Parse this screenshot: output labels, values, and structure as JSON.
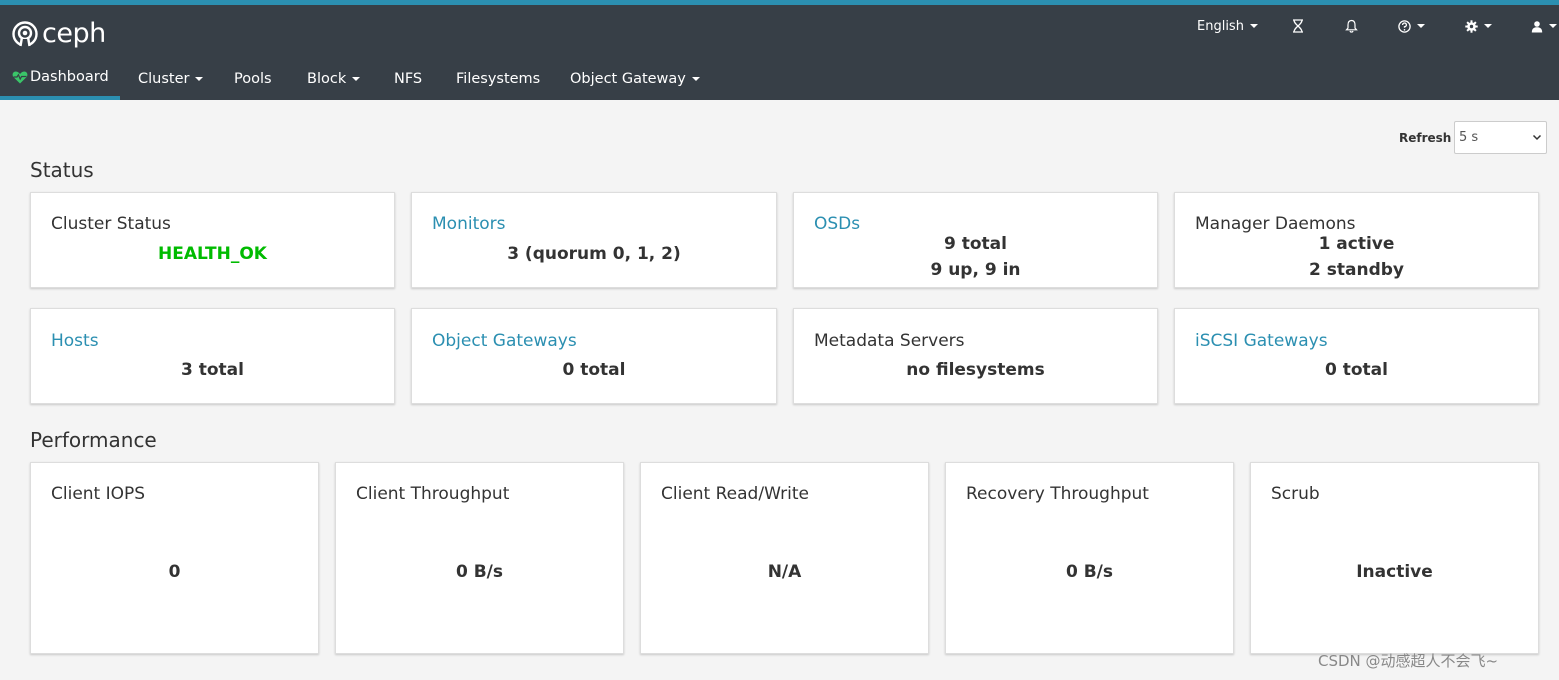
{
  "colors": {
    "navbar": "#373f47",
    "accent": "#2b8fb1",
    "health_ok": "#00bb00",
    "background": "#f4f4f4"
  },
  "header": {
    "logo_text": "ceph",
    "language": "English",
    "icons": [
      "hourglass-icon",
      "bell-icon",
      "help-icon",
      "gear-icon",
      "user-icon"
    ]
  },
  "nav": {
    "tabs": [
      {
        "label": "Dashboard",
        "active": true,
        "icon": "heartbeat-icon"
      },
      {
        "label": "Cluster",
        "dropdown": true
      },
      {
        "label": "Pools"
      },
      {
        "label": "Block",
        "dropdown": true
      },
      {
        "label": "NFS"
      },
      {
        "label": "Filesystems"
      },
      {
        "label": "Object Gateway",
        "dropdown": true
      }
    ]
  },
  "refresh": {
    "label": "Refresh",
    "value": "5 s"
  },
  "status": {
    "title": "Status",
    "cards": [
      {
        "title": "Cluster Status",
        "values": [
          "HEALTH_OK"
        ]
      },
      {
        "title": "Monitors",
        "values": [
          "3 (quorum 0, 1, 2)"
        ]
      },
      {
        "title": "OSDs",
        "values": [
          "9 total",
          "9 up, 9 in"
        ]
      },
      {
        "title": "Manager Daemons",
        "values": [
          "1 active",
          "2 standby"
        ]
      },
      {
        "title": "Hosts",
        "values": [
          "3 total"
        ]
      },
      {
        "title": "Object Gateways",
        "values": [
          "0 total"
        ]
      },
      {
        "title": "Metadata Servers",
        "values": [
          "no filesystems"
        ]
      },
      {
        "title": "iSCSI Gateways",
        "values": [
          "0 total"
        ]
      }
    ]
  },
  "performance": {
    "title": "Performance",
    "cards": [
      {
        "title": "Client IOPS",
        "value": "0"
      },
      {
        "title": "Client Throughput",
        "value": "0 B/s"
      },
      {
        "title": "Client Read/Write",
        "value": "N/A"
      },
      {
        "title": "Recovery Throughput",
        "value": "0 B/s"
      },
      {
        "title": "Scrub",
        "value": "Inactive"
      }
    ]
  },
  "watermark": "CSDN @动感超人不会飞~"
}
